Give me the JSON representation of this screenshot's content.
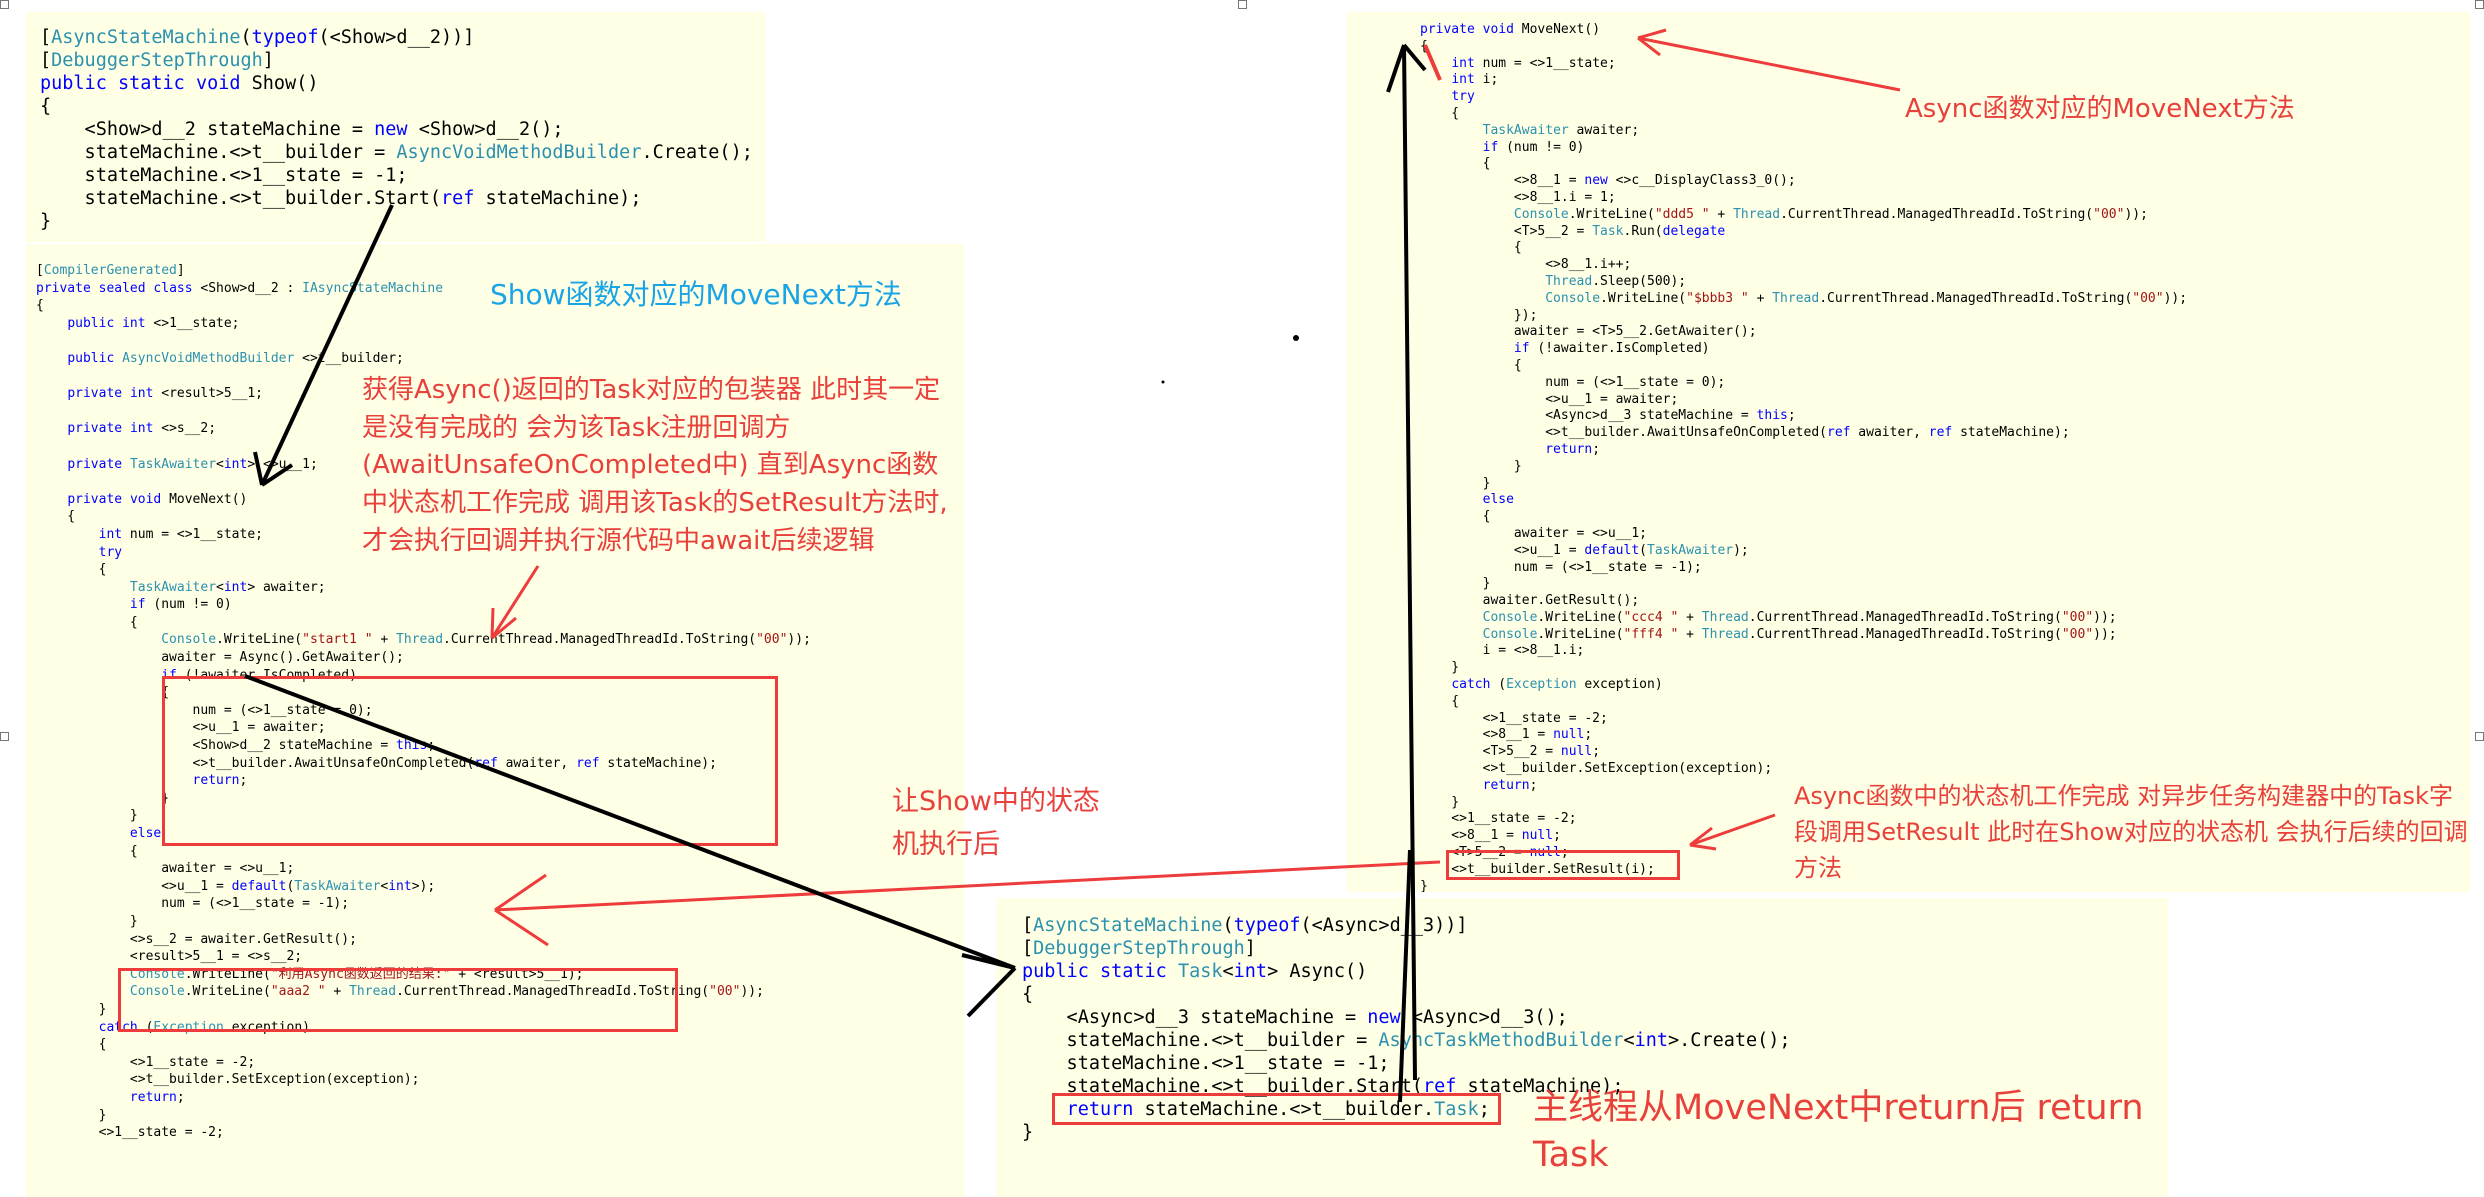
{
  "panel_show": {
    "lines": [
      "[AsyncStateMachine(typeof(<Show>d__2))]",
      "[DebuggerStepThrough]",
      "public static void Show()",
      "{",
      "    <Show>d__2 stateMachine = new <Show>d__2();",
      "    stateMachine.<>t__builder = AsyncVoidMethodBuilder.Create();",
      "    stateMachine.<>1__state = -1;",
      "    stateMachine.<>t__builder.Start(ref stateMachine);",
      "}"
    ]
  },
  "panel_show_class": {
    "lines": [
      "[CompilerGenerated]",
      "private sealed class <Show>d__2 : IAsyncStateMachine",
      "{",
      "    public int <>1__state;",
      "",
      "    public AsyncVoidMethodBuilder <>t__builder;",
      "",
      "    private int <result>5__1;",
      "",
      "    private int <>s__2;",
      "",
      "    private TaskAwaiter<int> <>u__1;",
      "",
      "    private void MoveNext()",
      "    {",
      "        int num = <>1__state;",
      "        try",
      "        {",
      "            TaskAwaiter<int> awaiter;",
      "            if (num != 0)",
      "            {",
      "                Console.WriteLine(\"start1 \" + Thread.CurrentThread.ManagedThreadId.ToString(\"00\"));",
      "                awaiter = Async().GetAwaiter();",
      "                if (!awaiter.IsCompleted)",
      "                {",
      "                    num = (<>1__state = 0);",
      "                    <>u__1 = awaiter;",
      "                    <Show>d__2 stateMachine = this;",
      "                    <>t__builder.AwaitUnsafeOnCompleted(ref awaiter, ref stateMachine);",
      "                    return;",
      "                }",
      "            }",
      "            else",
      "            {",
      "                awaiter = <>u__1;",
      "                <>u__1 = default(TaskAwaiter<int>);",
      "                num = (<>1__state = -1);",
      "            }",
      "            <>s__2 = awaiter.GetResult();",
      "            <result>5__1 = <>s__2;",
      "            Console.WriteLine(\"利用Async函数返回的结果:\" + <result>5__1);",
      "            Console.WriteLine(\"aaa2 \" + Thread.CurrentThread.ManagedThreadId.ToString(\"00\"));",
      "        }",
      "        catch (Exception exception)",
      "        {",
      "            <>1__state = -2;",
      "            <>t__builder.SetException(exception);",
      "            return;",
      "        }",
      "        <>1__state = -2;"
    ]
  },
  "panel_movenext": {
    "lines": [
      "private void MoveNext()",
      "{",
      "    int num = <>1__state;",
      "    int i;",
      "    try",
      "    {",
      "        TaskAwaiter awaiter;",
      "        if (num != 0)",
      "        {",
      "            <>8__1 = new <>c__DisplayClass3_0();",
      "            <>8__1.i = 1;",
      "            Console.WriteLine(\"ddd5 \" + Thread.CurrentThread.ManagedThreadId.ToString(\"00\"));",
      "            <T>5__2 = Task.Run(delegate",
      "            {",
      "                <>8__1.i++;",
      "                Thread.Sleep(500);",
      "                Console.WriteLine(\"$bbb3 \" + Thread.CurrentThread.ManagedThreadId.ToString(\"00\"));",
      "            });",
      "            awaiter = <T>5__2.GetAwaiter();",
      "            if (!awaiter.IsCompleted)",
      "            {",
      "                num = (<>1__state = 0);",
      "                <>u__1 = awaiter;",
      "                <Async>d__3 stateMachine = this;",
      "                <>t__builder.AwaitUnsafeOnCompleted(ref awaiter, ref stateMachine);",
      "                return;",
      "            }",
      "        }",
      "        else",
      "        {",
      "            awaiter = <>u__1;",
      "            <>u__1 = default(TaskAwaiter);",
      "            num = (<>1__state = -1);",
      "        }",
      "        awaiter.GetResult();",
      "        Console.WriteLine(\"ccc4 \" + Thread.CurrentThread.ManagedThreadId.ToString(\"00\"));",
      "        Console.WriteLine(\"fff4 \" + Thread.CurrentThread.ManagedThreadId.ToString(\"00\"));",
      "        i = <>8__1.i;",
      "    }",
      "    catch (Exception exception)",
      "    {",
      "        <>1__state = -2;",
      "        <>8__1 = null;",
      "        <T>5__2 = null;",
      "        <>t__builder.SetException(exception);",
      "        return;",
      "    }",
      "    <>1__state = -2;",
      "    <>8__1 = null;",
      "    <T>5__2 = null;",
      "    <>t__builder.SetResult(i);",
      "}"
    ]
  },
  "panel_async": {
    "lines": [
      "[AsyncStateMachine(typeof(<Async>d__3))]",
      "[DebuggerStepThrough]",
      "public static Task<int> Async()",
      "{",
      "    <Async>d__3 stateMachine = new <Async>d__3();",
      "    stateMachine.<>t__builder = AsyncTaskMethodBuilder<int>.Create();",
      "    stateMachine.<>1__state = -1;",
      "    stateMachine.<>t__builder.Start(ref stateMachine);",
      "    return stateMachine.<>t__builder.Task;",
      "}"
    ]
  },
  "annotations": {
    "show_movenext": "Show函数对应的MoveNext方法",
    "async_movenext": "Async函数对应的MoveNext方法",
    "await_explain": "获得Async()返回的Task对应的包装器 此时其一定是没有完成的 会为该Task注册回调方(AwaitUnsafeOnCompleted中) 直到Async函数中状态机工作完成 调用该Task的SetResult方法时,才会执行回调并执行源代码中await后续逻辑",
    "let_show_run": "让Show中的状态机执行后",
    "setresult_explain": "Async函数中的状态机工作完成 对异步任务构建器中的Task字段调用SetResult 此时在Show对应的状态机 会执行后续的回调方法",
    "main_return": "主线程从MoveNext中return后 return Task"
  },
  "colors": {
    "panel_bg": "#ffffe6",
    "annotation_red": "#e8403a",
    "annotation_blue": "#1aa4e6",
    "box_red": "#ee3b3b",
    "keyword_blue": "#0000ff",
    "type_teal": "#2b91af",
    "string_red": "#a31515"
  }
}
